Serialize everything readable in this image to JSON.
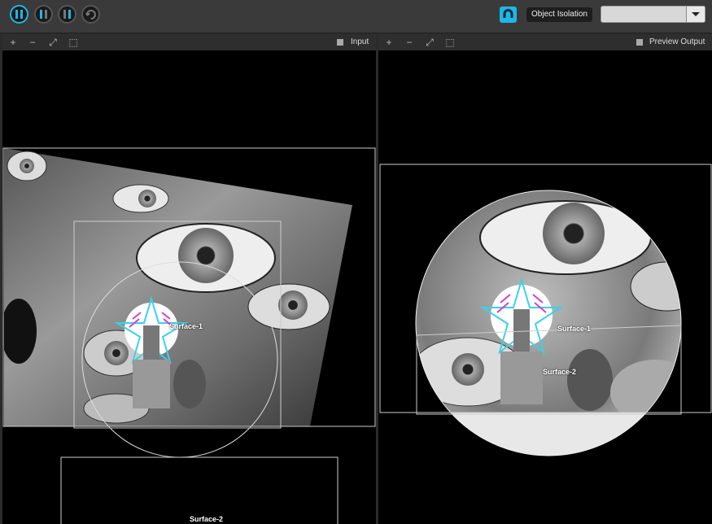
{
  "toolbar": {
    "buttons": [
      {
        "name": "pause-play-button",
        "icon": "pause-icon",
        "color": "#1fb6e8"
      },
      {
        "name": "pause-layer-button",
        "icon": "pause-icon",
        "color": "#4a4a4a"
      },
      {
        "name": "pause-output-button",
        "icon": "pause-icon",
        "color": "#4a4a4a"
      },
      {
        "name": "reset-button",
        "icon": "refresh-icon",
        "color": "#4a4a4a"
      }
    ],
    "isolation_icon": "magnet-icon",
    "isolation_label": "Object Isolation",
    "dropdown_value": "",
    "accent": "#1fb6e8"
  },
  "input_panel": {
    "title": "Input",
    "tools": [
      "+",
      "−",
      "⤢",
      "⬚"
    ],
    "surfaces": [
      {
        "label": "Surface-1"
      },
      {
        "label": "Surface-2"
      }
    ]
  },
  "preview_panel": {
    "title": "Preview Output",
    "tools": [
      "+",
      "−",
      "⤢",
      "⬚"
    ],
    "surfaces": [
      {
        "label": "Surface-1"
      },
      {
        "label": "Surface-2"
      }
    ]
  }
}
